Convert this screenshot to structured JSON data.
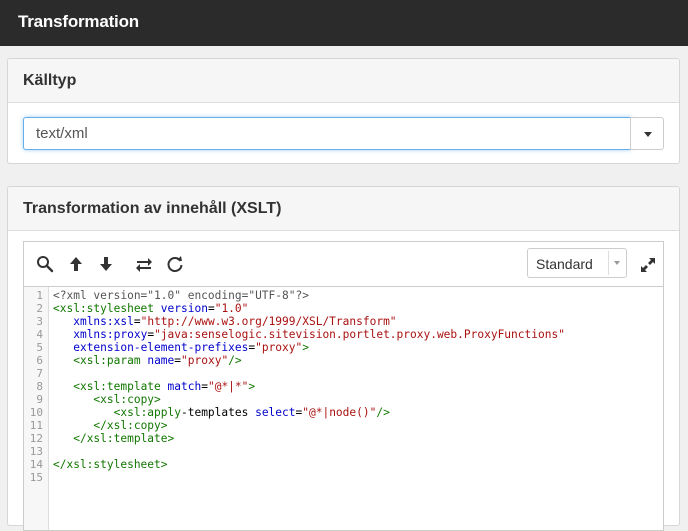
{
  "app": {
    "title": "Transformation"
  },
  "source_type": {
    "heading": "Källtyp",
    "value": "text/xml",
    "icon": "chevron-down-icon"
  },
  "xslt": {
    "heading": "Transformation av innehåll (XSLT)",
    "toolbar": {
      "icons": [
        "search-icon",
        "arrow-up-icon",
        "arrow-down-icon",
        "replace-icon",
        "refresh-icon",
        "expand-icon"
      ],
      "mode_label": "Standard"
    },
    "lines": [
      {
        "n": "1",
        "text": "<?xml version=\"1.0\" encoding=\"UTF-8\"?>"
      },
      {
        "n": "2",
        "text": "<xsl:stylesheet version=\"1.0\""
      },
      {
        "n": "3",
        "text": "   xmlns:xsl=\"http://www.w3.org/1999/XSL/Transform\""
      },
      {
        "n": "4",
        "text": "   xmlns:proxy=\"java:senselogic.sitevision.portlet.proxy.web.ProxyFunctions\""
      },
      {
        "n": "5",
        "text": "   extension-element-prefixes=\"proxy\">"
      },
      {
        "n": "6",
        "text": "   <xsl:param name=\"proxy\"/>"
      },
      {
        "n": "7",
        "text": ""
      },
      {
        "n": "8",
        "text": "   <xsl:template match=\"@*|*\">"
      },
      {
        "n": "9",
        "text": "      <xsl:copy>"
      },
      {
        "n": "10",
        "text": "         <xsl:apply-templates select=\"@*|node()\"/>"
      },
      {
        "n": "11",
        "text": "      </xsl:copy>"
      },
      {
        "n": "12",
        "text": "   </xsl:template>"
      },
      {
        "n": "13",
        "text": ""
      },
      {
        "n": "14",
        "text": "</xsl:stylesheet>"
      },
      {
        "n": "15",
        "text": ""
      }
    ]
  },
  "colors": {
    "titlebar": "#2b2b2b",
    "focus": "#66afe9",
    "tag": "#117700",
    "attr": "#0000cc",
    "string": "#aa1111"
  }
}
